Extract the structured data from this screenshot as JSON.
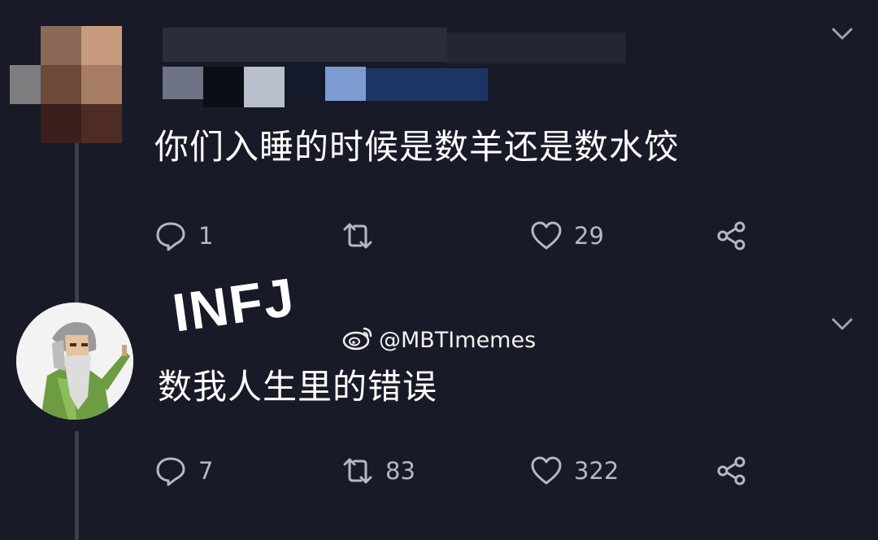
{
  "tweets": [
    {
      "text": "你们入睡的时候是数羊还是数水饺",
      "replies": "1",
      "retweets": "",
      "likes": "29"
    },
    {
      "text": "数我人生里的错误",
      "replies": "7",
      "retweets": "83",
      "likes": "322"
    }
  ],
  "overlay": {
    "label": "INFJ",
    "watermark": "@MBTImemes"
  },
  "colors": {
    "background": "#181b27",
    "icon": "#b4b8c4",
    "text": "#ffffff"
  },
  "icons": [
    "chevron-down-icon",
    "reply-icon",
    "retweet-icon",
    "like-icon",
    "share-icon",
    "weibo-icon"
  ]
}
